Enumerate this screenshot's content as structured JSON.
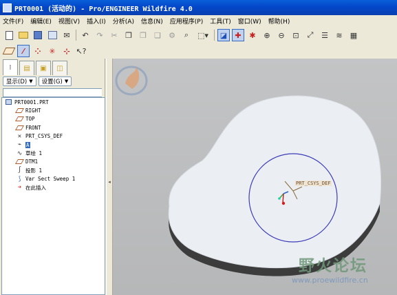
{
  "window": {
    "title": "PRT0001 (活动的) - Pro/ENGINEER Wildfire 4.0"
  },
  "menu": [
    "文件(F)",
    "编辑(E)",
    "视图(V)",
    "插入(I)",
    "分析(A)",
    "信息(N)",
    "应用程序(P)",
    "工具(T)",
    "窗口(W)",
    "帮助(H)"
  ],
  "panel": {
    "show_button": "显示(D)",
    "settings_button": "设置(G)",
    "tree": [
      {
        "label": "PRT0001.PRT",
        "icon": "part-icon",
        "level": 0
      },
      {
        "label": "RIGHT",
        "icon": "datum-plane-icon",
        "level": 1
      },
      {
        "label": "TOP",
        "icon": "datum-plane-icon",
        "level": 1
      },
      {
        "label": "FRONT",
        "icon": "datum-plane-icon",
        "level": 1
      },
      {
        "label": "PRT_CSYS_DEF",
        "icon": "csys-icon",
        "level": 1
      },
      {
        "label": "A",
        "icon": "datum-axis-icon",
        "level": 1,
        "selected": true
      },
      {
        "label": "草绘 1",
        "icon": "sketch-icon",
        "level": 1
      },
      {
        "label": "DTM1",
        "icon": "datum-plane-icon",
        "level": 1
      },
      {
        "label": "投影 1",
        "icon": "projection-icon",
        "level": 1
      },
      {
        "label": "Var Sect Sweep 1",
        "icon": "sweep-icon",
        "level": 1
      },
      {
        "label": "在此插入",
        "icon": "insert-here-icon",
        "level": 1
      }
    ]
  },
  "viewport": {
    "csys_label": "PRT_CSYS_DEF",
    "watermark_text": "野火论坛",
    "watermark_url": "www.proewildfire.cn",
    "background_color": "#bdbebf",
    "part_color": "#ebeef2",
    "circle_color": "#3b3bb8"
  }
}
